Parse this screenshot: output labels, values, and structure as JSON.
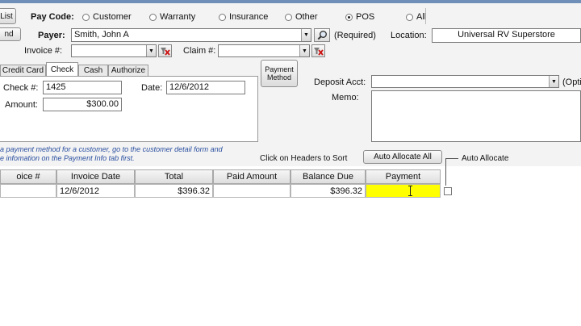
{
  "toolbar": {
    "list_label": "List",
    "left_btn_label": "nd"
  },
  "pay_code": {
    "label": "Pay Code:",
    "options": [
      {
        "label": "Customer",
        "selected": false
      },
      {
        "label": "Warranty",
        "selected": false
      },
      {
        "label": "Insurance",
        "selected": false
      },
      {
        "label": "Other",
        "selected": false
      },
      {
        "label": "POS",
        "selected": true
      },
      {
        "label": "All",
        "selected": false
      }
    ]
  },
  "payer": {
    "label": "Payer:",
    "value": "Smith, John A",
    "required_note": "(Required)"
  },
  "location": {
    "label": "Location:",
    "value": "Universal RV Superstore"
  },
  "invoice": {
    "label": "Invoice #:",
    "value": ""
  },
  "claim": {
    "label": "Claim #:",
    "value": ""
  },
  "payment_method_btn": {
    "line1": "Payment",
    "line2": "Method"
  },
  "tabs": [
    {
      "label": "Credit Card",
      "active": false
    },
    {
      "label": "Check",
      "active": true
    },
    {
      "label": "Cash",
      "active": false
    },
    {
      "label": "Authorize",
      "active": false
    }
  ],
  "check": {
    "check_num_label": "Check #:",
    "check_num_value": "1425",
    "date_label": "Date:",
    "date_value": "12/6/2012",
    "amount_label": "Amount:",
    "amount_value": "$300.00"
  },
  "deposit": {
    "label": "Deposit Acct:",
    "value": "",
    "option_note": "(Optio"
  },
  "memo": {
    "label": "Memo:",
    "value": ""
  },
  "hint": {
    "line1": "a payment method for a customer, go to the customer detail form and",
    "line2": "e infomation on the Payment Info tab first."
  },
  "sort_hint": "Click on Headers to Sort",
  "auto_allocate_all_label": "Auto Allocate All",
  "auto_allocate_label": "Auto Allocate",
  "table": {
    "columns": [
      "oice #",
      "Invoice Date",
      "Total",
      "Paid Amount",
      "Balance Due",
      "Payment"
    ],
    "rows": [
      {
        "invoice": "",
        "date": "12/6/2012",
        "total": "$396.32",
        "paid": "",
        "balance": "$396.32",
        "payment": ""
      }
    ]
  },
  "colors": {
    "payment_highlight": "#ffff00",
    "hint_text": "#2a4fa0",
    "title_bar": "#6f8fb8"
  }
}
